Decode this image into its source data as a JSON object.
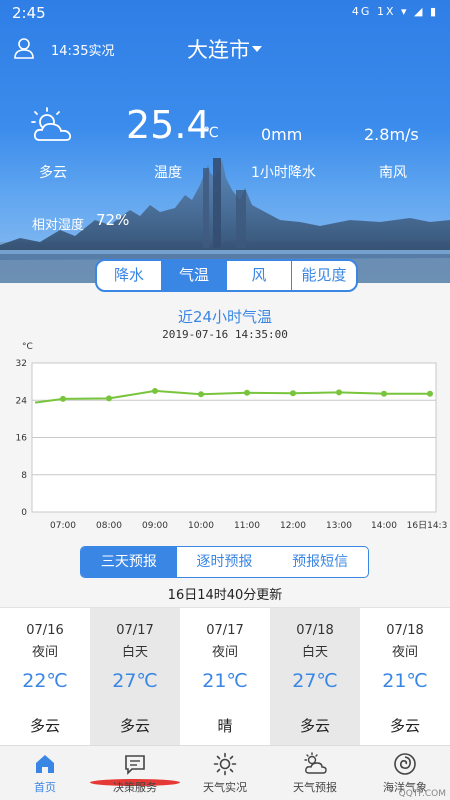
{
  "status": {
    "time": "2:45",
    "icons": "4G 1X ▾ ◢ ▮"
  },
  "header": {
    "obs_time": "14:35实况",
    "city": "大连市"
  },
  "current": {
    "weather": "多云",
    "temperature": "25.4",
    "temperature_unit": "℃",
    "temperature_label": "温度",
    "rain": "0mm",
    "rain_label": "1小时降水",
    "wind": "2.8m/s",
    "wind_label": "南风",
    "humidity_label": "相对湿度",
    "humidity": "72%"
  },
  "tabs": [
    "降水",
    "气温",
    "风",
    "能见度"
  ],
  "chart_header": {
    "title": "近24小时气温",
    "time": "2019-07-16 14:35:00"
  },
  "chart_data": {
    "type": "line",
    "ylabel": "°C",
    "yticks": [
      32,
      24,
      16,
      8,
      0
    ],
    "ylim": [
      0,
      32
    ],
    "x_labels": [
      "07:00",
      "08:00",
      "09:00",
      "10:00",
      "11:00",
      "12:00",
      "13:00",
      "14:00",
      "16日14:3"
    ],
    "x": [
      "06:00",
      "07:00",
      "08:00",
      "09:00",
      "10:00",
      "11:00",
      "12:00",
      "13:00",
      "14:00",
      "14:35"
    ],
    "values": [
      23.5,
      24.3,
      24.4,
      26.0,
      25.3,
      25.6,
      25.5,
      25.7,
      25.4,
      25.4
    ],
    "markers": [
      false,
      true,
      true,
      true,
      true,
      true,
      true,
      true,
      true,
      true
    ],
    "line_color": "#78c43c",
    "grid": true
  },
  "forecast_tabs": [
    "三天预报",
    "逐时预报",
    "预报短信"
  ],
  "updated": "16日14时40分更新",
  "forecast": [
    {
      "date": "07/16",
      "period": "夜间",
      "temp": "22℃",
      "cond": "多云"
    },
    {
      "date": "07/17",
      "period": "白天",
      "temp": "27℃",
      "cond": "多云"
    },
    {
      "date": "07/17",
      "period": "夜间",
      "temp": "21℃",
      "cond": "晴"
    },
    {
      "date": "07/18",
      "period": "白天",
      "temp": "27℃",
      "cond": "多云"
    },
    {
      "date": "07/18",
      "period": "夜间",
      "temp": "21℃",
      "cond": "多云"
    }
  ],
  "nav": [
    {
      "label": "首页",
      "icon": "home-icon"
    },
    {
      "label": "决策服务",
      "icon": "message-icon"
    },
    {
      "label": "天气实况",
      "icon": "sun-icon"
    },
    {
      "label": "天气预报",
      "icon": "cloud-sun-icon"
    },
    {
      "label": "海洋气象",
      "icon": "spiral-icon"
    }
  ],
  "watermark": "QQTF.COM",
  "colors": {
    "accent": "#3a86e4",
    "line": "#78c43c"
  }
}
